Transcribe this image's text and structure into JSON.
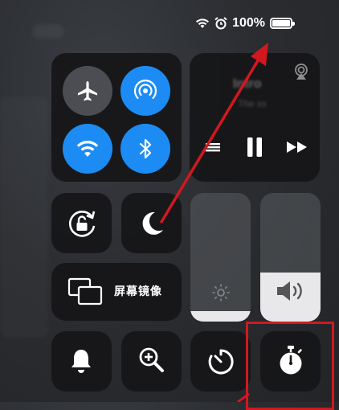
{
  "status_bar": {
    "battery_text": "100%",
    "battery_level": 1.0,
    "icons": [
      "wifi-icon",
      "alarm-icon",
      "battery-icon"
    ]
  },
  "connectivity": {
    "airplane_mode": false,
    "airdrop": true,
    "wifi": true,
    "bluetooth": true
  },
  "music": {
    "title": "Intro",
    "artist": "The xx"
  },
  "screen_mirroring": {
    "label": "屏幕镜像"
  },
  "sliders": {
    "brightness_level": 0.08,
    "volume_level": 0.38
  },
  "bottom_row": [
    "bell-icon",
    "magnifier-icon",
    "timer-icon",
    "stopwatch-icon"
  ],
  "colors": {
    "accent_blue": "#1c8cf4",
    "annotation_red": "#d2181f",
    "tile_bg": "#161618"
  }
}
